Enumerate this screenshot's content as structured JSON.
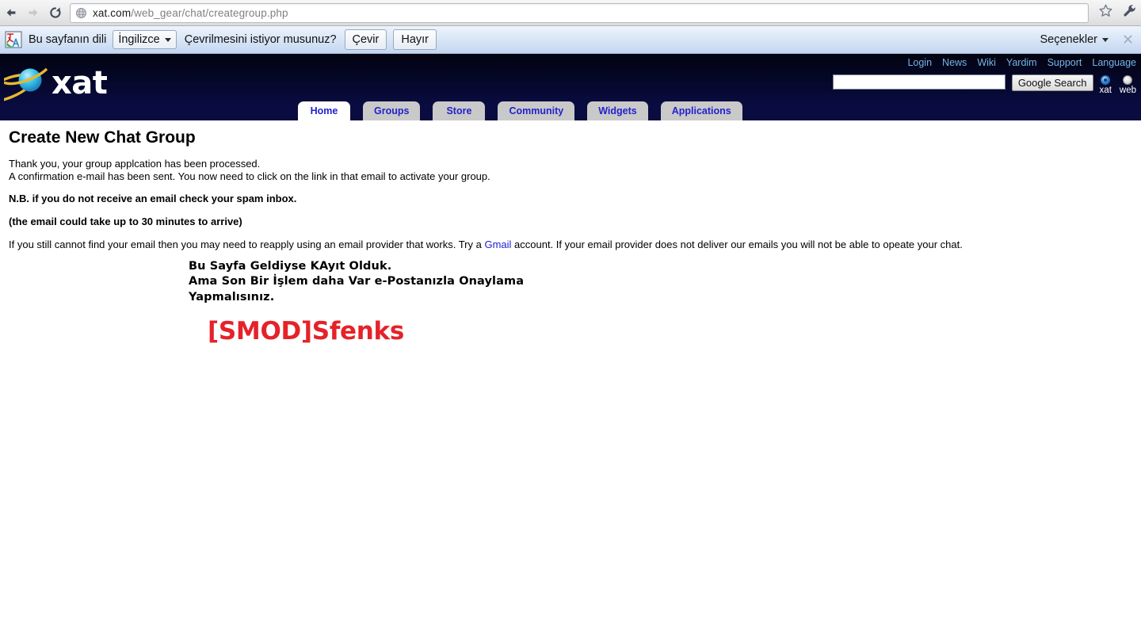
{
  "browser": {
    "back_icon": "back-arrow-icon",
    "forward_icon": "forward-arrow-icon",
    "reload_icon": "reload-icon",
    "page_icon": "globe-icon",
    "url_host": "xat.com",
    "url_path": "/web_gear/chat/creategroup.php",
    "bookmark_icon": "star-icon",
    "menu_icon": "wrench-icon"
  },
  "translate_bar": {
    "icon": "translate-icon",
    "label": "Bu sayfanın dili",
    "language_value": "İngilizce",
    "question": "Çevrilmesini istiyor musunuz?",
    "translate_button": "Çevir",
    "no_button": "Hayır",
    "options_label": "Seçenekler",
    "close_icon": "close-icon"
  },
  "site_header": {
    "logo_icon": "xat-planet-logo-icon",
    "logo_text": "xat",
    "top_links": [
      "Login",
      "News",
      "Wiki",
      "Yardim",
      "Support",
      "Language"
    ],
    "search": {
      "value": "",
      "button_label": "Google Search",
      "scopes": [
        {
          "label": "xat",
          "selected": true
        },
        {
          "label": "web",
          "selected": false
        }
      ]
    },
    "accent_link_color": "#78b4e8",
    "background_color": "#0a0b3d"
  },
  "tabs": [
    {
      "label": "Home",
      "active": true
    },
    {
      "label": "Groups",
      "active": false
    },
    {
      "label": "Store",
      "active": false
    },
    {
      "label": "Community",
      "active": false
    },
    {
      "label": "Widgets",
      "active": false
    },
    {
      "label": "Applications",
      "active": false
    }
  ],
  "main": {
    "title": "Create New Chat Group",
    "line1": "Thank you, your group applcation has been processed.",
    "line2": "A confirmation e-mail has been sent. You now need to click on the link in that email to activate your group.",
    "note": "N.B. if you do not receive an email check your spam inbox.",
    "timing": "(the email could take up to 30 minutes to arrive)",
    "final_prefix": "If you still cannot find your email then you may need to reapply using an email provider that works. Try a ",
    "final_link": "Gmail",
    "final_suffix": " account. If your email provider does not deliver our emails you will not be able to opeate your chat.",
    "turkish_line1": "Bu Sayfa Geldiyse KAyıt Olduk.",
    "turkish_line2": "Ama Son Bir İşlem daha Var e-Postanızla Onaylama",
    "turkish_line3": "Yapmalısınız.",
    "signature": "[SMOD]Sfenks",
    "signature_color": "#e52229",
    "link_color": "#2222cc"
  }
}
